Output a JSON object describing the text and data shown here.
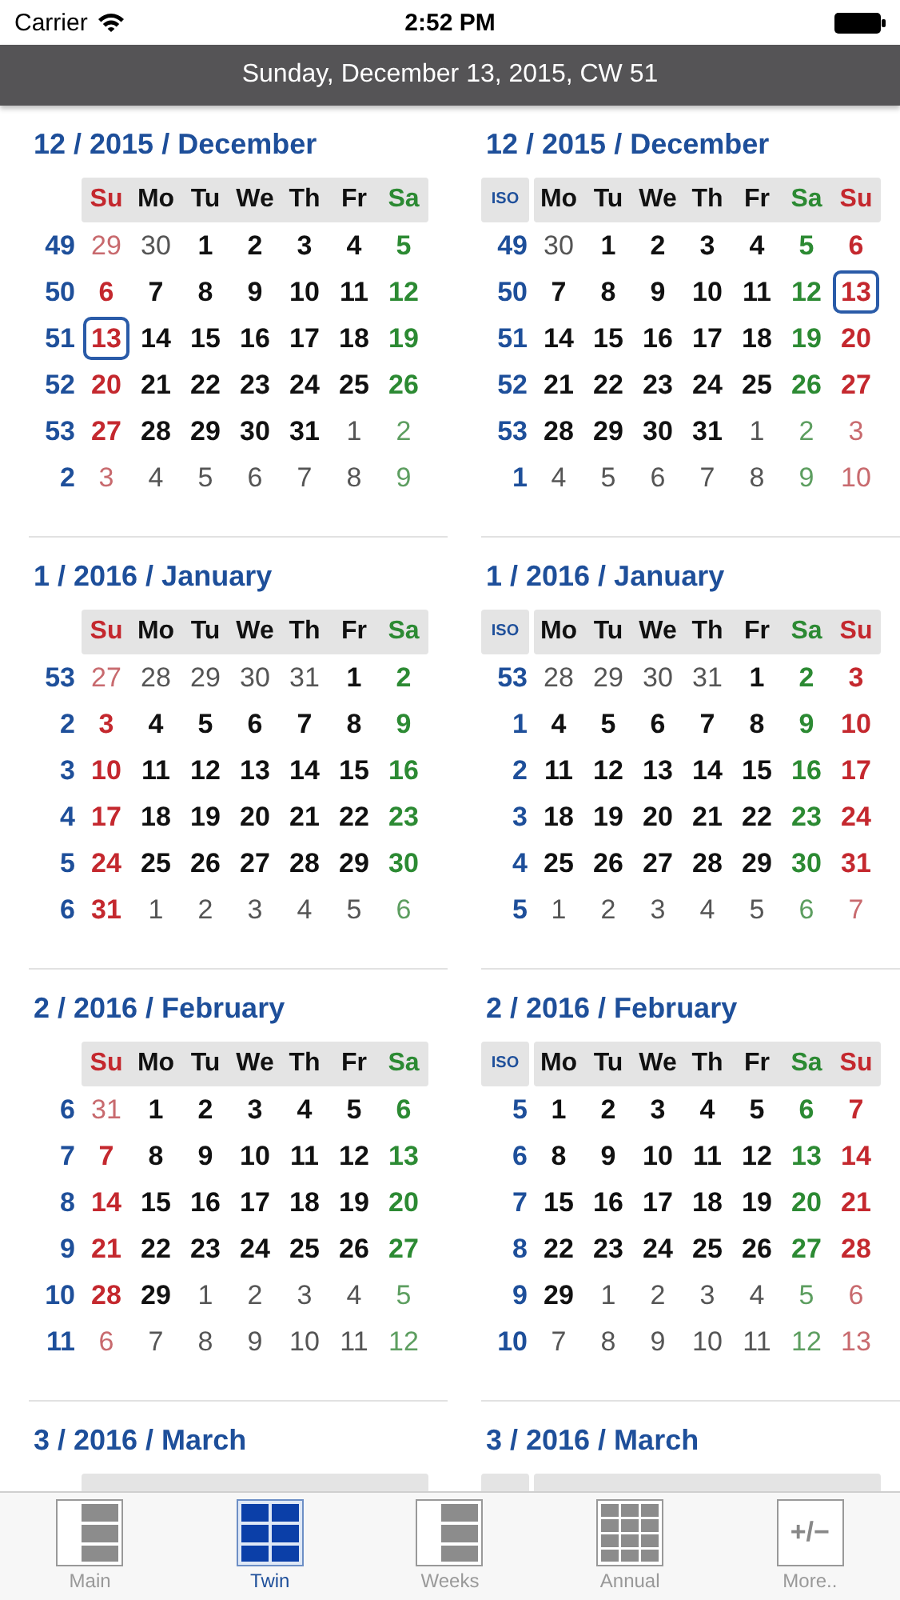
{
  "status_bar": {
    "carrier": "Carrier",
    "time": "2:52 PM"
  },
  "header": {
    "title": "Sunday, December 13, 2015, CW 51"
  },
  "calendars": [
    {
      "title": "12 / 2015 / December",
      "kind": "us",
      "weekdays": [
        {
          "label": "Su",
          "kind": "sun"
        },
        {
          "label": "Mo",
          "kind": "day"
        },
        {
          "label": "Tu",
          "kind": "day"
        },
        {
          "label": "We",
          "kind": "day"
        },
        {
          "label": "Th",
          "kind": "day"
        },
        {
          "label": "Fr",
          "kind": "day"
        },
        {
          "label": "Sa",
          "kind": "sat"
        }
      ],
      "rows": [
        {
          "week": "49",
          "days": [
            {
              "day": "29",
              "outside": true,
              "selected": false
            },
            {
              "day": "30",
              "outside": true,
              "selected": false
            },
            {
              "day": "1",
              "outside": false,
              "selected": false
            },
            {
              "day": "2",
              "outside": false,
              "selected": false
            },
            {
              "day": "3",
              "outside": false,
              "selected": false
            },
            {
              "day": "4",
              "outside": false,
              "selected": false
            },
            {
              "day": "5",
              "outside": false,
              "selected": false
            }
          ]
        },
        {
          "week": "50",
          "days": [
            {
              "day": "6",
              "outside": false,
              "selected": false
            },
            {
              "day": "7",
              "outside": false,
              "selected": false
            },
            {
              "day": "8",
              "outside": false,
              "selected": false
            },
            {
              "day": "9",
              "outside": false,
              "selected": false
            },
            {
              "day": "10",
              "outside": false,
              "selected": false
            },
            {
              "day": "11",
              "outside": false,
              "selected": false
            },
            {
              "day": "12",
              "outside": false,
              "selected": false
            }
          ]
        },
        {
          "week": "51",
          "days": [
            {
              "day": "13",
              "outside": false,
              "selected": true
            },
            {
              "day": "14",
              "outside": false,
              "selected": false
            },
            {
              "day": "15",
              "outside": false,
              "selected": false
            },
            {
              "day": "16",
              "outside": false,
              "selected": false
            },
            {
              "day": "17",
              "outside": false,
              "selected": false
            },
            {
              "day": "18",
              "outside": false,
              "selected": false
            },
            {
              "day": "19",
              "outside": false,
              "selected": false
            }
          ]
        },
        {
          "week": "52",
          "days": [
            {
              "day": "20",
              "outside": false,
              "selected": false
            },
            {
              "day": "21",
              "outside": false,
              "selected": false
            },
            {
              "day": "22",
              "outside": false,
              "selected": false
            },
            {
              "day": "23",
              "outside": false,
              "selected": false
            },
            {
              "day": "24",
              "outside": false,
              "selected": false
            },
            {
              "day": "25",
              "outside": false,
              "selected": false
            },
            {
              "day": "26",
              "outside": false,
              "selected": false
            }
          ]
        },
        {
          "week": "53",
          "days": [
            {
              "day": "27",
              "outside": false,
              "selected": false
            },
            {
              "day": "28",
              "outside": false,
              "selected": false
            },
            {
              "day": "29",
              "outside": false,
              "selected": false
            },
            {
              "day": "30",
              "outside": false,
              "selected": false
            },
            {
              "day": "31",
              "outside": false,
              "selected": false
            },
            {
              "day": "1",
              "outside": true,
              "selected": false
            },
            {
              "day": "2",
              "outside": true,
              "selected": false
            }
          ]
        },
        {
          "week": "2",
          "days": [
            {
              "day": "3",
              "outside": true,
              "selected": false
            },
            {
              "day": "4",
              "outside": true,
              "selected": false
            },
            {
              "day": "5",
              "outside": true,
              "selected": false
            },
            {
              "day": "6",
              "outside": true,
              "selected": false
            },
            {
              "day": "7",
              "outside": true,
              "selected": false
            },
            {
              "day": "8",
              "outside": true,
              "selected": false
            },
            {
              "day": "9",
              "outside": true,
              "selected": false
            }
          ]
        }
      ]
    },
    {
      "title": "12 / 2015 / December",
      "kind": "iso",
      "iso_label": "ISO",
      "weekdays": [
        {
          "label": "Mo",
          "kind": "day"
        },
        {
          "label": "Tu",
          "kind": "day"
        },
        {
          "label": "We",
          "kind": "day"
        },
        {
          "label": "Th",
          "kind": "day"
        },
        {
          "label": "Fr",
          "kind": "day"
        },
        {
          "label": "Sa",
          "kind": "sat"
        },
        {
          "label": "Su",
          "kind": "sun"
        }
      ],
      "rows": [
        {
          "week": "49",
          "days": [
            {
              "day": "30",
              "outside": true,
              "selected": false
            },
            {
              "day": "1",
              "outside": false,
              "selected": false
            },
            {
              "day": "2",
              "outside": false,
              "selected": false
            },
            {
              "day": "3",
              "outside": false,
              "selected": false
            },
            {
              "day": "4",
              "outside": false,
              "selected": false
            },
            {
              "day": "5",
              "outside": false,
              "selected": false
            },
            {
              "day": "6",
              "outside": false,
              "selected": false
            }
          ]
        },
        {
          "week": "50",
          "days": [
            {
              "day": "7",
              "outside": false,
              "selected": false
            },
            {
              "day": "8",
              "outside": false,
              "selected": false
            },
            {
              "day": "9",
              "outside": false,
              "selected": false
            },
            {
              "day": "10",
              "outside": false,
              "selected": false
            },
            {
              "day": "11",
              "outside": false,
              "selected": false
            },
            {
              "day": "12",
              "outside": false,
              "selected": false
            },
            {
              "day": "13",
              "outside": false,
              "selected": true
            }
          ]
        },
        {
          "week": "51",
          "days": [
            {
              "day": "14",
              "outside": false,
              "selected": false
            },
            {
              "day": "15",
              "outside": false,
              "selected": false
            },
            {
              "day": "16",
              "outside": false,
              "selected": false
            },
            {
              "day": "17",
              "outside": false,
              "selected": false
            },
            {
              "day": "18",
              "outside": false,
              "selected": false
            },
            {
              "day": "19",
              "outside": false,
              "selected": false
            },
            {
              "day": "20",
              "outside": false,
              "selected": false
            }
          ]
        },
        {
          "week": "52",
          "days": [
            {
              "day": "21",
              "outside": false,
              "selected": false
            },
            {
              "day": "22",
              "outside": false,
              "selected": false
            },
            {
              "day": "23",
              "outside": false,
              "selected": false
            },
            {
              "day": "24",
              "outside": false,
              "selected": false
            },
            {
              "day": "25",
              "outside": false,
              "selected": false
            },
            {
              "day": "26",
              "outside": false,
              "selected": false
            },
            {
              "day": "27",
              "outside": false,
              "selected": false
            }
          ]
        },
        {
          "week": "53",
          "days": [
            {
              "day": "28",
              "outside": false,
              "selected": false
            },
            {
              "day": "29",
              "outside": false,
              "selected": false
            },
            {
              "day": "30",
              "outside": false,
              "selected": false
            },
            {
              "day": "31",
              "outside": false,
              "selected": false
            },
            {
              "day": "1",
              "outside": true,
              "selected": false
            },
            {
              "day": "2",
              "outside": true,
              "selected": false
            },
            {
              "day": "3",
              "outside": true,
              "selected": false
            }
          ]
        },
        {
          "week": "1",
          "days": [
            {
              "day": "4",
              "outside": true,
              "selected": false
            },
            {
              "day": "5",
              "outside": true,
              "selected": false
            },
            {
              "day": "6",
              "outside": true,
              "selected": false
            },
            {
              "day": "7",
              "outside": true,
              "selected": false
            },
            {
              "day": "8",
              "outside": true,
              "selected": false
            },
            {
              "day": "9",
              "outside": true,
              "selected": false
            },
            {
              "day": "10",
              "outside": true,
              "selected": false
            }
          ]
        }
      ]
    },
    {
      "title": "1 / 2016 / January",
      "kind": "us",
      "weekdays": [
        {
          "label": "Su",
          "kind": "sun"
        },
        {
          "label": "Mo",
          "kind": "day"
        },
        {
          "label": "Tu",
          "kind": "day"
        },
        {
          "label": "We",
          "kind": "day"
        },
        {
          "label": "Th",
          "kind": "day"
        },
        {
          "label": "Fr",
          "kind": "day"
        },
        {
          "label": "Sa",
          "kind": "sat"
        }
      ],
      "rows": [
        {
          "week": "53",
          "days": [
            {
              "day": "27",
              "outside": true,
              "selected": false
            },
            {
              "day": "28",
              "outside": true,
              "selected": false
            },
            {
              "day": "29",
              "outside": true,
              "selected": false
            },
            {
              "day": "30",
              "outside": true,
              "selected": false
            },
            {
              "day": "31",
              "outside": true,
              "selected": false
            },
            {
              "day": "1",
              "outside": false,
              "selected": false
            },
            {
              "day": "2",
              "outside": false,
              "selected": false
            }
          ]
        },
        {
          "week": "2",
          "days": [
            {
              "day": "3",
              "outside": false,
              "selected": false
            },
            {
              "day": "4",
              "outside": false,
              "selected": false
            },
            {
              "day": "5",
              "outside": false,
              "selected": false
            },
            {
              "day": "6",
              "outside": false,
              "selected": false
            },
            {
              "day": "7",
              "outside": false,
              "selected": false
            },
            {
              "day": "8",
              "outside": false,
              "selected": false
            },
            {
              "day": "9",
              "outside": false,
              "selected": false
            }
          ]
        },
        {
          "week": "3",
          "days": [
            {
              "day": "10",
              "outside": false,
              "selected": false
            },
            {
              "day": "11",
              "outside": false,
              "selected": false
            },
            {
              "day": "12",
              "outside": false,
              "selected": false
            },
            {
              "day": "13",
              "outside": false,
              "selected": false
            },
            {
              "day": "14",
              "outside": false,
              "selected": false
            },
            {
              "day": "15",
              "outside": false,
              "selected": false
            },
            {
              "day": "16",
              "outside": false,
              "selected": false
            }
          ]
        },
        {
          "week": "4",
          "days": [
            {
              "day": "17",
              "outside": false,
              "selected": false
            },
            {
              "day": "18",
              "outside": false,
              "selected": false
            },
            {
              "day": "19",
              "outside": false,
              "selected": false
            },
            {
              "day": "20",
              "outside": false,
              "selected": false
            },
            {
              "day": "21",
              "outside": false,
              "selected": false
            },
            {
              "day": "22",
              "outside": false,
              "selected": false
            },
            {
              "day": "23",
              "outside": false,
              "selected": false
            }
          ]
        },
        {
          "week": "5",
          "days": [
            {
              "day": "24",
              "outside": false,
              "selected": false
            },
            {
              "day": "25",
              "outside": false,
              "selected": false
            },
            {
              "day": "26",
              "outside": false,
              "selected": false
            },
            {
              "day": "27",
              "outside": false,
              "selected": false
            },
            {
              "day": "28",
              "outside": false,
              "selected": false
            },
            {
              "day": "29",
              "outside": false,
              "selected": false
            },
            {
              "day": "30",
              "outside": false,
              "selected": false
            }
          ]
        },
        {
          "week": "6",
          "days": [
            {
              "day": "31",
              "outside": false,
              "selected": false
            },
            {
              "day": "1",
              "outside": true,
              "selected": false
            },
            {
              "day": "2",
              "outside": true,
              "selected": false
            },
            {
              "day": "3",
              "outside": true,
              "selected": false
            },
            {
              "day": "4",
              "outside": true,
              "selected": false
            },
            {
              "day": "5",
              "outside": true,
              "selected": false
            },
            {
              "day": "6",
              "outside": true,
              "selected": false
            }
          ]
        }
      ]
    },
    {
      "title": "1 / 2016 / January",
      "kind": "iso",
      "iso_label": "ISO",
      "weekdays": [
        {
          "label": "Mo",
          "kind": "day"
        },
        {
          "label": "Tu",
          "kind": "day"
        },
        {
          "label": "We",
          "kind": "day"
        },
        {
          "label": "Th",
          "kind": "day"
        },
        {
          "label": "Fr",
          "kind": "day"
        },
        {
          "label": "Sa",
          "kind": "sat"
        },
        {
          "label": "Su",
          "kind": "sun"
        }
      ],
      "rows": [
        {
          "week": "53",
          "days": [
            {
              "day": "28",
              "outside": true,
              "selected": false
            },
            {
              "day": "29",
              "outside": true,
              "selected": false
            },
            {
              "day": "30",
              "outside": true,
              "selected": false
            },
            {
              "day": "31",
              "outside": true,
              "selected": false
            },
            {
              "day": "1",
              "outside": false,
              "selected": false
            },
            {
              "day": "2",
              "outside": false,
              "selected": false
            },
            {
              "day": "3",
              "outside": false,
              "selected": false
            }
          ]
        },
        {
          "week": "1",
          "days": [
            {
              "day": "4",
              "outside": false,
              "selected": false
            },
            {
              "day": "5",
              "outside": false,
              "selected": false
            },
            {
              "day": "6",
              "outside": false,
              "selected": false
            },
            {
              "day": "7",
              "outside": false,
              "selected": false
            },
            {
              "day": "8",
              "outside": false,
              "selected": false
            },
            {
              "day": "9",
              "outside": false,
              "selected": false
            },
            {
              "day": "10",
              "outside": false,
              "selected": false
            }
          ]
        },
        {
          "week": "2",
          "days": [
            {
              "day": "11",
              "outside": false,
              "selected": false
            },
            {
              "day": "12",
              "outside": false,
              "selected": false
            },
            {
              "day": "13",
              "outside": false,
              "selected": false
            },
            {
              "day": "14",
              "outside": false,
              "selected": false
            },
            {
              "day": "15",
              "outside": false,
              "selected": false
            },
            {
              "day": "16",
              "outside": false,
              "selected": false
            },
            {
              "day": "17",
              "outside": false,
              "selected": false
            }
          ]
        },
        {
          "week": "3",
          "days": [
            {
              "day": "18",
              "outside": false,
              "selected": false
            },
            {
              "day": "19",
              "outside": false,
              "selected": false
            },
            {
              "day": "20",
              "outside": false,
              "selected": false
            },
            {
              "day": "21",
              "outside": false,
              "selected": false
            },
            {
              "day": "22",
              "outside": false,
              "selected": false
            },
            {
              "day": "23",
              "outside": false,
              "selected": false
            },
            {
              "day": "24",
              "outside": false,
              "selected": false
            }
          ]
        },
        {
          "week": "4",
          "days": [
            {
              "day": "25",
              "outside": false,
              "selected": false
            },
            {
              "day": "26",
              "outside": false,
              "selected": false
            },
            {
              "day": "27",
              "outside": false,
              "selected": false
            },
            {
              "day": "28",
              "outside": false,
              "selected": false
            },
            {
              "day": "29",
              "outside": false,
              "selected": false
            },
            {
              "day": "30",
              "outside": false,
              "selected": false
            },
            {
              "day": "31",
              "outside": false,
              "selected": false
            }
          ]
        },
        {
          "week": "5",
          "days": [
            {
              "day": "1",
              "outside": true,
              "selected": false
            },
            {
              "day": "2",
              "outside": true,
              "selected": false
            },
            {
              "day": "3",
              "outside": true,
              "selected": false
            },
            {
              "day": "4",
              "outside": true,
              "selected": false
            },
            {
              "day": "5",
              "outside": true,
              "selected": false
            },
            {
              "day": "6",
              "outside": true,
              "selected": false
            },
            {
              "day": "7",
              "outside": true,
              "selected": false
            }
          ]
        }
      ]
    },
    {
      "title": "2 / 2016 / February",
      "kind": "us",
      "weekdays": [
        {
          "label": "Su",
          "kind": "sun"
        },
        {
          "label": "Mo",
          "kind": "day"
        },
        {
          "label": "Tu",
          "kind": "day"
        },
        {
          "label": "We",
          "kind": "day"
        },
        {
          "label": "Th",
          "kind": "day"
        },
        {
          "label": "Fr",
          "kind": "day"
        },
        {
          "label": "Sa",
          "kind": "sat"
        }
      ],
      "rows": [
        {
          "week": "6",
          "days": [
            {
              "day": "31",
              "outside": true,
              "selected": false
            },
            {
              "day": "1",
              "outside": false,
              "selected": false
            },
            {
              "day": "2",
              "outside": false,
              "selected": false
            },
            {
              "day": "3",
              "outside": false,
              "selected": false
            },
            {
              "day": "4",
              "outside": false,
              "selected": false
            },
            {
              "day": "5",
              "outside": false,
              "selected": false
            },
            {
              "day": "6",
              "outside": false,
              "selected": false
            }
          ]
        },
        {
          "week": "7",
          "days": [
            {
              "day": "7",
              "outside": false,
              "selected": false
            },
            {
              "day": "8",
              "outside": false,
              "selected": false
            },
            {
              "day": "9",
              "outside": false,
              "selected": false
            },
            {
              "day": "10",
              "outside": false,
              "selected": false
            },
            {
              "day": "11",
              "outside": false,
              "selected": false
            },
            {
              "day": "12",
              "outside": false,
              "selected": false
            },
            {
              "day": "13",
              "outside": false,
              "selected": false
            }
          ]
        },
        {
          "week": "8",
          "days": [
            {
              "day": "14",
              "outside": false,
              "selected": false
            },
            {
              "day": "15",
              "outside": false,
              "selected": false
            },
            {
              "day": "16",
              "outside": false,
              "selected": false
            },
            {
              "day": "17",
              "outside": false,
              "selected": false
            },
            {
              "day": "18",
              "outside": false,
              "selected": false
            },
            {
              "day": "19",
              "outside": false,
              "selected": false
            },
            {
              "day": "20",
              "outside": false,
              "selected": false
            }
          ]
        },
        {
          "week": "9",
          "days": [
            {
              "day": "21",
              "outside": false,
              "selected": false
            },
            {
              "day": "22",
              "outside": false,
              "selected": false
            },
            {
              "day": "23",
              "outside": false,
              "selected": false
            },
            {
              "day": "24",
              "outside": false,
              "selected": false
            },
            {
              "day": "25",
              "outside": false,
              "selected": false
            },
            {
              "day": "26",
              "outside": false,
              "selected": false
            },
            {
              "day": "27",
              "outside": false,
              "selected": false
            }
          ]
        },
        {
          "week": "10",
          "days": [
            {
              "day": "28",
              "outside": false,
              "selected": false
            },
            {
              "day": "29",
              "outside": false,
              "selected": false
            },
            {
              "day": "1",
              "outside": true,
              "selected": false
            },
            {
              "day": "2",
              "outside": true,
              "selected": false
            },
            {
              "day": "3",
              "outside": true,
              "selected": false
            },
            {
              "day": "4",
              "outside": true,
              "selected": false
            },
            {
              "day": "5",
              "outside": true,
              "selected": false
            }
          ]
        },
        {
          "week": "11",
          "days": [
            {
              "day": "6",
              "outside": true,
              "selected": false
            },
            {
              "day": "7",
              "outside": true,
              "selected": false
            },
            {
              "day": "8",
              "outside": true,
              "selected": false
            },
            {
              "day": "9",
              "outside": true,
              "selected": false
            },
            {
              "day": "10",
              "outside": true,
              "selected": false
            },
            {
              "day": "11",
              "outside": true,
              "selected": false
            },
            {
              "day": "12",
              "outside": true,
              "selected": false
            }
          ]
        }
      ]
    },
    {
      "title": "2 / 2016 / February",
      "kind": "iso",
      "iso_label": "ISO",
      "weekdays": [
        {
          "label": "Mo",
          "kind": "day"
        },
        {
          "label": "Tu",
          "kind": "day"
        },
        {
          "label": "We",
          "kind": "day"
        },
        {
          "label": "Th",
          "kind": "day"
        },
        {
          "label": "Fr",
          "kind": "day"
        },
        {
          "label": "Sa",
          "kind": "sat"
        },
        {
          "label": "Su",
          "kind": "sun"
        }
      ],
      "rows": [
        {
          "week": "5",
          "days": [
            {
              "day": "1",
              "outside": false,
              "selected": false
            },
            {
              "day": "2",
              "outside": false,
              "selected": false
            },
            {
              "day": "3",
              "outside": false,
              "selected": false
            },
            {
              "day": "4",
              "outside": false,
              "selected": false
            },
            {
              "day": "5",
              "outside": false,
              "selected": false
            },
            {
              "day": "6",
              "outside": false,
              "selected": false
            },
            {
              "day": "7",
              "outside": false,
              "selected": false
            }
          ]
        },
        {
          "week": "6",
          "days": [
            {
              "day": "8",
              "outside": false,
              "selected": false
            },
            {
              "day": "9",
              "outside": false,
              "selected": false
            },
            {
              "day": "10",
              "outside": false,
              "selected": false
            },
            {
              "day": "11",
              "outside": false,
              "selected": false
            },
            {
              "day": "12",
              "outside": false,
              "selected": false
            },
            {
              "day": "13",
              "outside": false,
              "selected": false
            },
            {
              "day": "14",
              "outside": false,
              "selected": false
            }
          ]
        },
        {
          "week": "7",
          "days": [
            {
              "day": "15",
              "outside": false,
              "selected": false
            },
            {
              "day": "16",
              "outside": false,
              "selected": false
            },
            {
              "day": "17",
              "outside": false,
              "selected": false
            },
            {
              "day": "18",
              "outside": false,
              "selected": false
            },
            {
              "day": "19",
              "outside": false,
              "selected": false
            },
            {
              "day": "20",
              "outside": false,
              "selected": false
            },
            {
              "day": "21",
              "outside": false,
              "selected": false
            }
          ]
        },
        {
          "week": "8",
          "days": [
            {
              "day": "22",
              "outside": false,
              "selected": false
            },
            {
              "day": "23",
              "outside": false,
              "selected": false
            },
            {
              "day": "24",
              "outside": false,
              "selected": false
            },
            {
              "day": "25",
              "outside": false,
              "selected": false
            },
            {
              "day": "26",
              "outside": false,
              "selected": false
            },
            {
              "day": "27",
              "outside": false,
              "selected": false
            },
            {
              "day": "28",
              "outside": false,
              "selected": false
            }
          ]
        },
        {
          "week": "9",
          "days": [
            {
              "day": "29",
              "outside": false,
              "selected": false
            },
            {
              "day": "1",
              "outside": true,
              "selected": false
            },
            {
              "day": "2",
              "outside": true,
              "selected": false
            },
            {
              "day": "3",
              "outside": true,
              "selected": false
            },
            {
              "day": "4",
              "outside": true,
              "selected": false
            },
            {
              "day": "5",
              "outside": true,
              "selected": false
            },
            {
              "day": "6",
              "outside": true,
              "selected": false
            }
          ]
        },
        {
          "week": "10",
          "days": [
            {
              "day": "7",
              "outside": true,
              "selected": false
            },
            {
              "day": "8",
              "outside": true,
              "selected": false
            },
            {
              "day": "9",
              "outside": true,
              "selected": false
            },
            {
              "day": "10",
              "outside": true,
              "selected": false
            },
            {
              "day": "11",
              "outside": true,
              "selected": false
            },
            {
              "day": "12",
              "outside": true,
              "selected": false
            },
            {
              "day": "13",
              "outside": true,
              "selected": false
            }
          ]
        }
      ]
    },
    {
      "title": "3 / 2016 / March",
      "kind": "us"
    },
    {
      "title": "3 / 2016 / March",
      "kind": "iso"
    }
  ],
  "tab_bar": [
    {
      "label": "Main",
      "kind": "main",
      "selected": false
    },
    {
      "label": "Twin",
      "kind": "twin",
      "selected": true
    },
    {
      "label": "Weeks",
      "kind": "weeks",
      "selected": false
    },
    {
      "label": "Annual",
      "kind": "annual",
      "selected": false
    },
    {
      "label": "More..",
      "kind": "more",
      "glyph": "+/−",
      "selected": false
    }
  ]
}
